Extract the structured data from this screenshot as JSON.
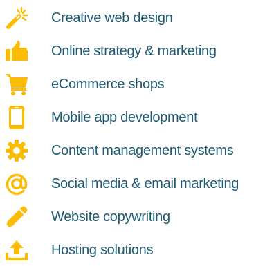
{
  "services": {
    "accent_color": "#fbbc05",
    "text_color": "#1f5a73",
    "items": [
      {
        "label": "Creative web design",
        "icon": "magic-wand-icon"
      },
      {
        "label": "Online strategy & marketing",
        "icon": "thumbs-up-icon"
      },
      {
        "label": "eCommerce shops",
        "icon": "shopping-cart-icon"
      },
      {
        "label": "Mobile app development",
        "icon": "smartphone-icon"
      },
      {
        "label": "Content management systems",
        "icon": "gear-icon"
      },
      {
        "label": "Social media & email marketing",
        "icon": "at-sign-icon"
      },
      {
        "label": "Website copywriting",
        "icon": "pencil-icon"
      },
      {
        "label": "Hosting solutions",
        "icon": "upload-icon"
      }
    ]
  }
}
